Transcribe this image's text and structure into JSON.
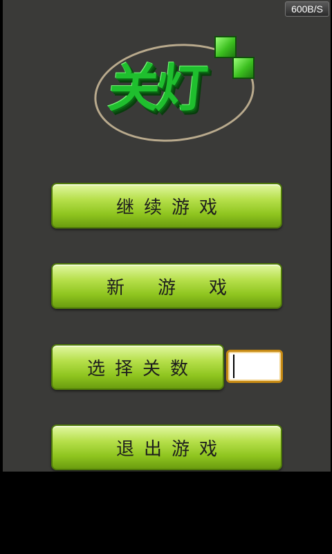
{
  "status_bar": {
    "speed": "600B/S"
  },
  "logo": {
    "text": "关灯"
  },
  "menu": {
    "continue_label": "继续游戏",
    "new_label": "新游戏",
    "select_label": "选择关数",
    "exit_label": "退出游戏"
  },
  "level_input": {
    "value": ""
  },
  "colors": {
    "background": "#3a3a38",
    "button_green": "#a6d43a",
    "logo_green": "#1fbf2e",
    "input_border": "#c78a14"
  }
}
